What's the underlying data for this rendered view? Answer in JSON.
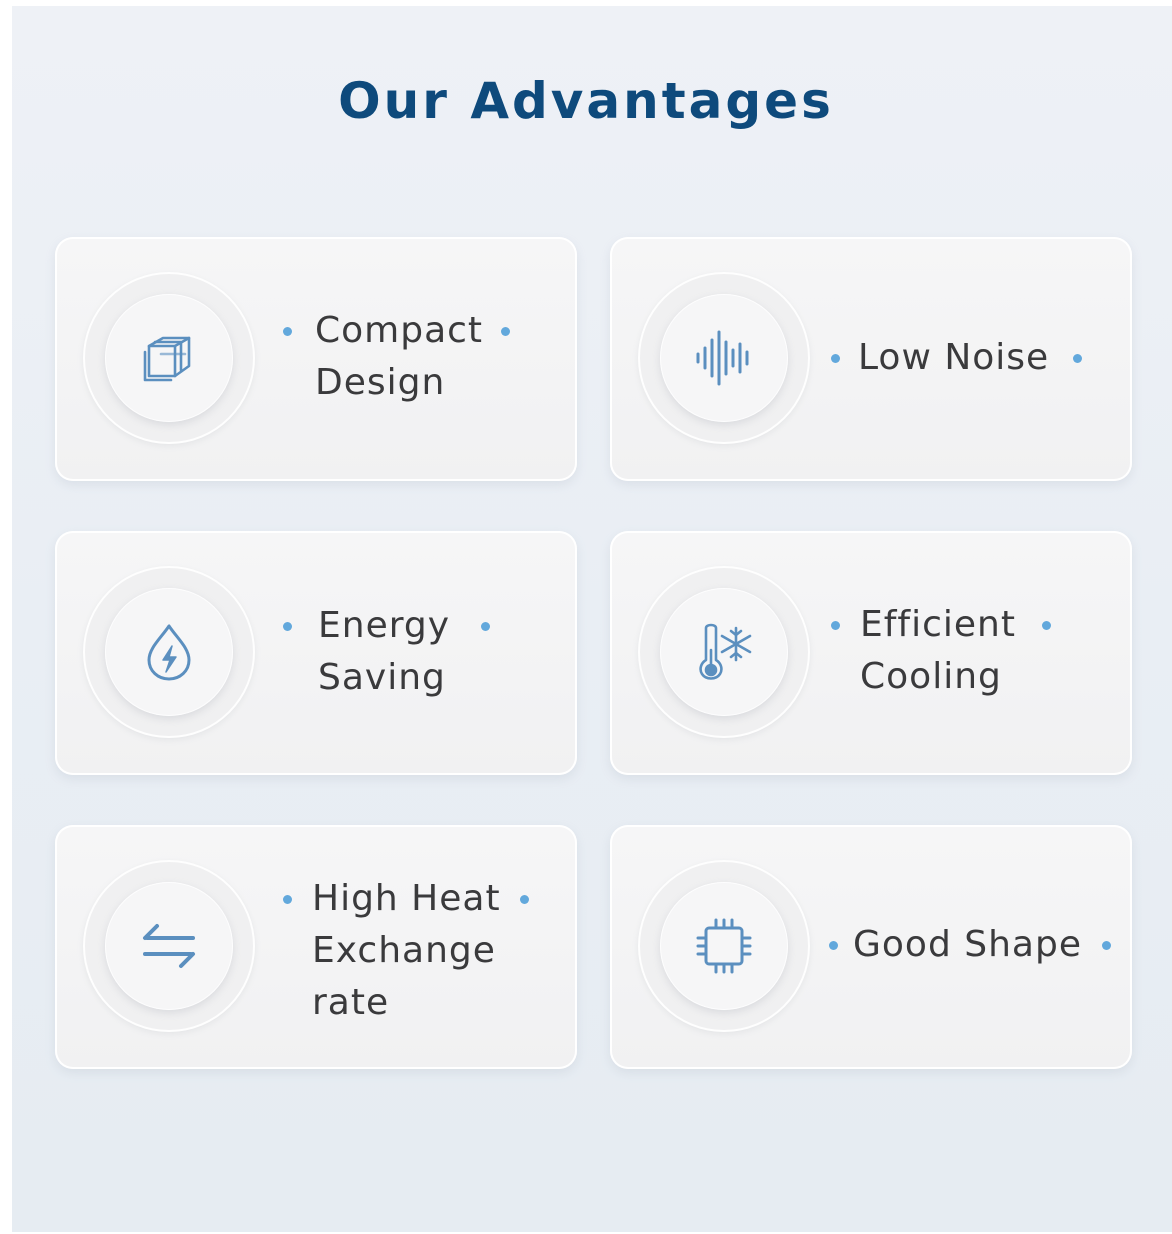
{
  "title": "Our Advantages",
  "accent_color": "#62a8dc",
  "icon_color": "#5b8fbf",
  "cards": [
    {
      "icon": "cube-icon",
      "label_lines": [
        "Compact",
        "Design"
      ]
    },
    {
      "icon": "sound-wave-icon",
      "label_lines": [
        "Low Noise"
      ]
    },
    {
      "icon": "energy-drop-icon",
      "label_lines": [
        "Energy",
        "Saving"
      ]
    },
    {
      "icon": "thermometer-snowflake-icon",
      "label_lines": [
        "Efficient",
        "Cooling"
      ]
    },
    {
      "icon": "exchange-arrows-icon",
      "label_lines": [
        "High Heat",
        "Exchange",
        "rate"
      ]
    },
    {
      "icon": "chip-icon",
      "label_lines": [
        "Good Shape"
      ]
    }
  ]
}
